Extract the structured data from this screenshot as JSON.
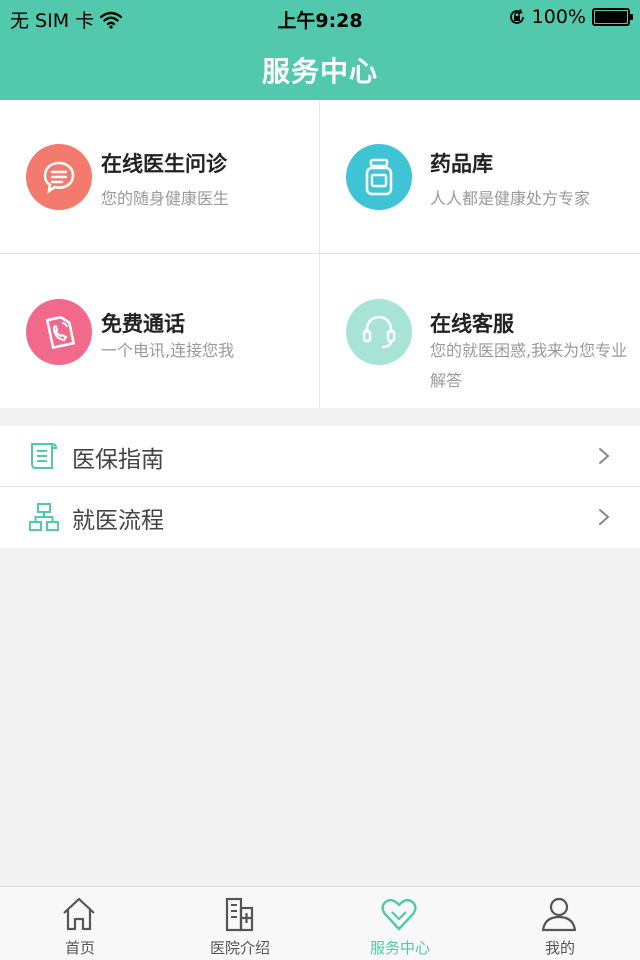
{
  "status_bar": {
    "carrier": "无 SIM 卡",
    "time": "上午9:28",
    "battery": "100%",
    "battery_level": 1.0,
    "icons": [
      "wifi-icon",
      "orientation-lock-icon",
      "battery-icon"
    ]
  },
  "nav": {
    "title": "服务中心"
  },
  "services": [
    {
      "title": "在线医生问诊",
      "subtitle": "您的随身健康医生",
      "icon": "chat-bubble-icon",
      "color": "#f47a6e"
    },
    {
      "title": "药品库",
      "subtitle": "人人都是健康处方专家",
      "icon": "medicine-bottle-icon",
      "color": "#3fc4d6"
    },
    {
      "title": "免费通话",
      "subtitle": "一个电讯,连接您我",
      "icon": "phone-note-icon",
      "color": "#f2698c"
    },
    {
      "title": "在线客服",
      "subtitle": "您的就医困惑,我来为您专业解答",
      "icon": "headset-icon",
      "color": "#a7e3d6"
    }
  ],
  "list": [
    {
      "label": "医保指南",
      "icon": "scroll-icon"
    },
    {
      "label": "就医流程",
      "icon": "flowchart-icon"
    }
  ],
  "tabs": [
    {
      "label": "首页",
      "icon": "home-icon",
      "active": false
    },
    {
      "label": "医院介绍",
      "icon": "hospital-icon",
      "active": false
    },
    {
      "label": "服务中心",
      "icon": "heart-icon",
      "active": true
    },
    {
      "label": "我的",
      "icon": "user-icon",
      "active": false
    }
  ],
  "colors": {
    "accent": "#52c8ac",
    "background": "#f2f2f2"
  }
}
